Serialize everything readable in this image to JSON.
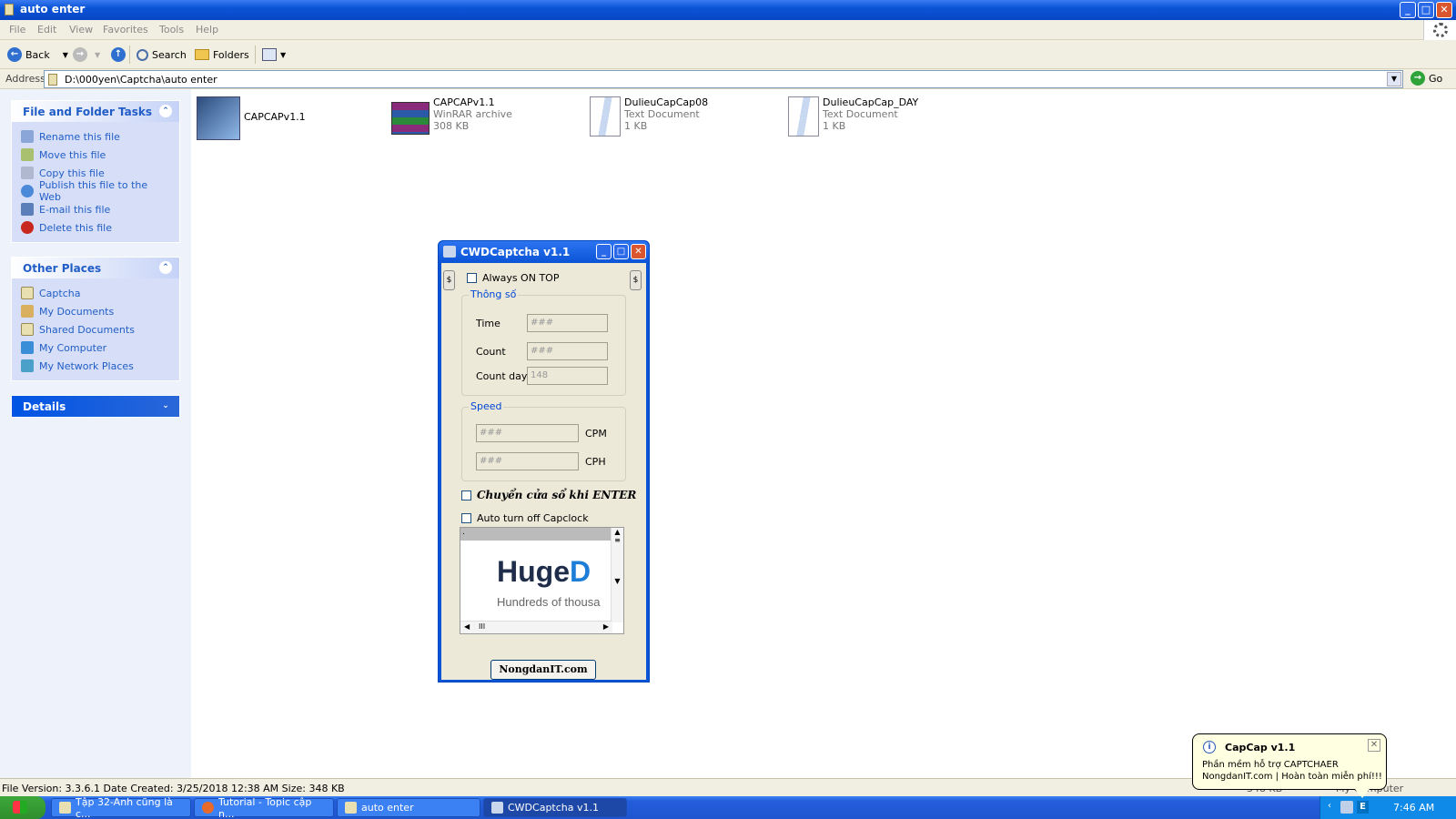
{
  "window": {
    "title": "auto enter"
  },
  "menu": [
    "File",
    "Edit",
    "View",
    "Favorites",
    "Tools",
    "Help"
  ],
  "toolbar": {
    "back": "Back",
    "search": "Search",
    "folders": "Folders"
  },
  "address": {
    "label": "Address",
    "path": "D:\\000yen\\Captcha\\auto enter",
    "go": "Go"
  },
  "panels": {
    "tasks": {
      "title": "File and Folder Tasks",
      "items": [
        "Rename this file",
        "Move this file",
        "Copy this file",
        "Publish this file to the Web",
        "E-mail this file",
        "Delete this file"
      ]
    },
    "places": {
      "title": "Other Places",
      "items": [
        "Captcha",
        "My Documents",
        "Shared Documents",
        "My Computer",
        "My Network Places"
      ]
    },
    "details": {
      "title": "Details"
    }
  },
  "files": [
    {
      "name": "CAPCAPv1.1",
      "type": "",
      "size": ""
    },
    {
      "name": "CAPCAPv1.1",
      "type": "WinRAR archive",
      "size": "308 KB"
    },
    {
      "name": "DulieuCapCap08",
      "type": "Text Document",
      "size": "1 KB"
    },
    {
      "name": "DulieuCapCap_DAY",
      "type": "Text Document",
      "size": "1 KB"
    }
  ],
  "status": {
    "text": "File Version: 3.3.6.1 Date Created: 3/25/2018 12:38 AM Size: 348 KB",
    "size": "348 KB",
    "computer": "My Computer"
  },
  "dialog": {
    "title": "CWDCaptcha v1.1",
    "side_btn": "$",
    "always_on_top": "Always ON TOP",
    "group1": {
      "label": "Thông số",
      "time_label": "Time",
      "time_value": "###",
      "count_label": "Count",
      "count_value": "###",
      "countday_label": "Count day",
      "countday_value": "148"
    },
    "group2": {
      "label": "Speed",
      "cpm_value": "###",
      "cpm_label": "CPM",
      "cph_value": "###",
      "cph_label": "CPH"
    },
    "chuyen": "Chuyển cửa sổ khi ENTER",
    "capslock": "Auto turn off Capclock",
    "ad": {
      "bar": ".",
      "brand_a": "Huge",
      "brand_b": "D",
      "tagline": "Hundreds of thousa",
      "hscroll": "III"
    },
    "link_button": "NongdanIT.com"
  },
  "taskbar": {
    "items": [
      "Tập 32-Anh cũng là c...",
      "Tutorial - Topic cập n...",
      "auto enter",
      "CWDCaptcha v1.1"
    ],
    "tray_letter": "E",
    "clock": "7:46 AM"
  },
  "balloon": {
    "title": "CapCap v1.1",
    "line1": "Phần mềm hỗ trợ CAPTCHAER",
    "line2": "NongdanIT.com | Hoàn toàn miễn phí!!!"
  }
}
